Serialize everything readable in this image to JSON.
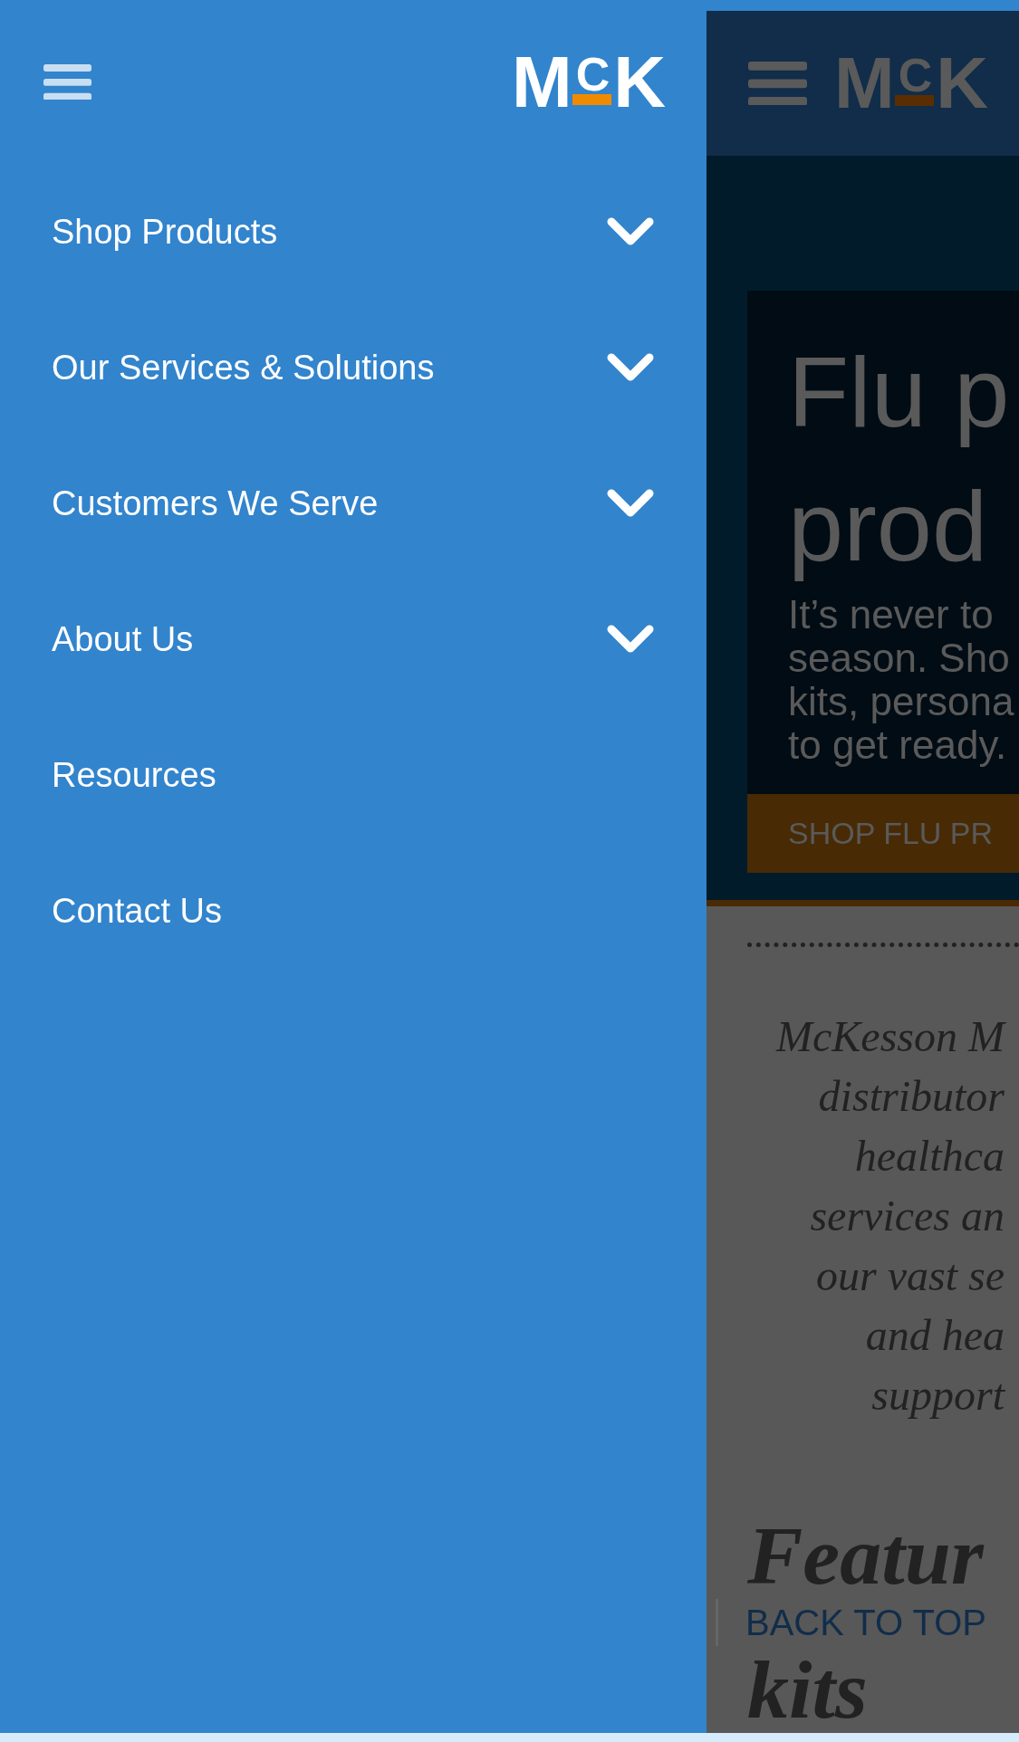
{
  "drawer": {
    "logo": [
      "M",
      "C",
      "K"
    ],
    "items": [
      {
        "label": "Shop Products",
        "expandable": true
      },
      {
        "label": "Our Services & Solutions",
        "expandable": true
      },
      {
        "label": "Customers We Serve",
        "expandable": true
      },
      {
        "label": "About Us",
        "expandable": true
      },
      {
        "label": "Resources",
        "expandable": false
      },
      {
        "label": "Contact Us",
        "expandable": false
      }
    ]
  },
  "page": {
    "logo": [
      "M",
      "C",
      "K"
    ],
    "hero": {
      "title_lines": [
        "Flu p",
        "prod"
      ],
      "body_lines": [
        "It’s never to",
        "season. Sho",
        "kits, persona",
        "to get ready."
      ],
      "button": "SHOP FLU PR"
    },
    "intro_lines": [
      "McKesson M",
      "distributor",
      "healthca",
      "services an",
      "our vast se",
      "and hea",
      "support"
    ],
    "heading_lines": [
      "Featur",
      "kits"
    ],
    "back_to_top": "BACK TO TOP"
  }
}
